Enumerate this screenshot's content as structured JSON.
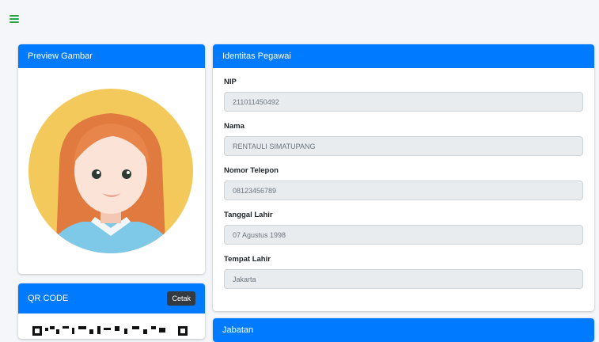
{
  "colors": {
    "primary": "#007bff",
    "menu_icon": "#28a745",
    "page_bg": "#f4f6f9",
    "input_bg": "#e9ecef",
    "cetak_btn": "#343a40"
  },
  "topbar": {
    "menu_icon": "hamburger-menu-icon"
  },
  "preview": {
    "title": "Preview Gambar"
  },
  "qr": {
    "title": "QR CODE",
    "print_label": "Cetak"
  },
  "identity": {
    "title": "Identitas Pegawai",
    "fields": [
      {
        "label": "NIP",
        "value": "211011450492"
      },
      {
        "label": "Nama",
        "value": "RENTAULI SIMATUPANG"
      },
      {
        "label": "Nomor Telepon",
        "value": "08123456789"
      },
      {
        "label": "Tanggal Lahir",
        "value": "07 Agustus 1998"
      },
      {
        "label": "Tempat Lahir",
        "value": "Jakarta"
      }
    ]
  },
  "jabatan": {
    "title": "Jabatan"
  }
}
